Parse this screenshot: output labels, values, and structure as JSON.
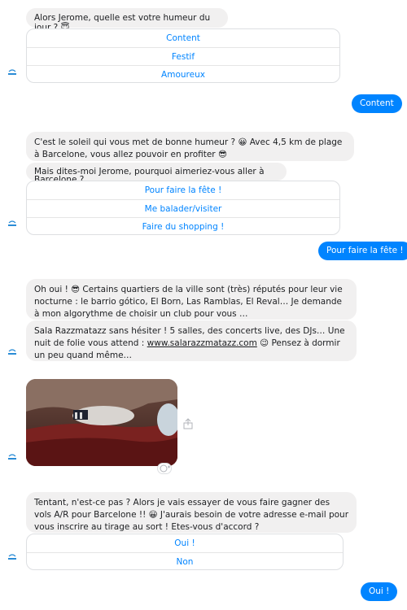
{
  "messages": {
    "m1": {
      "text": "Alors Jerome, quelle est votre humeur du jour ? 😇"
    },
    "qr1": [
      "Content",
      "Festif",
      "Amoureux"
    ],
    "u1": "Content",
    "m2": {
      "text": "C'est le soleil qui vous met de bonne humeur ? 😀 Avec 4,5 km de plage à Barcelone, vous allez pouvoir en profiter 😎"
    },
    "m3": {
      "text": "Mais dites-moi Jerome, pourquoi aimeriez-vous aller à Barcelone ?"
    },
    "qr2": [
      "Pour faire la fête !",
      "Me balader/visiter",
      "Faire du shopping !"
    ],
    "u2": "Pour faire la fête !",
    "m4": {
      "text": "Oh oui ! 😎 Certains quartiers de la ville sont (très) réputés pour leur vie nocturne : le barrio gótico, El Born, Las Ramblas, El Reval… Je demande à mon algorythme de choisir un club pour vous …"
    },
    "m5": {
      "before": "Sala Razzmatazz sans hésiter ! 5 salles, des concerts live, des DJs… Une nuit de folie vous attend : ",
      "link": "www.salarazzmatazz.com",
      "after": " 😉 Pensez à dormir un peu quand même…"
    },
    "m6": {
      "text": "Tentant, n'est-ce pas ? Alors je vais essayer de vous faire gagner des vols A/R pour Barcelone !! 😀 J'aurais besoin de votre adresse e-mail pour vous inscrire au tirage au sort ! Etes-vous d'accord ?"
    },
    "qr3": [
      "Oui  !",
      "Non"
    ],
    "u3": "Oui  !"
  },
  "avatar_label": "vueling",
  "colors": {
    "accent": "#0084ff",
    "bot_bubble": "#f1f0f0",
    "avatar": "#2a8cd6"
  },
  "icons": {
    "share": "share-icon",
    "react": "smiley-react-icon",
    "avatar": "vueling-avatar-icon"
  }
}
